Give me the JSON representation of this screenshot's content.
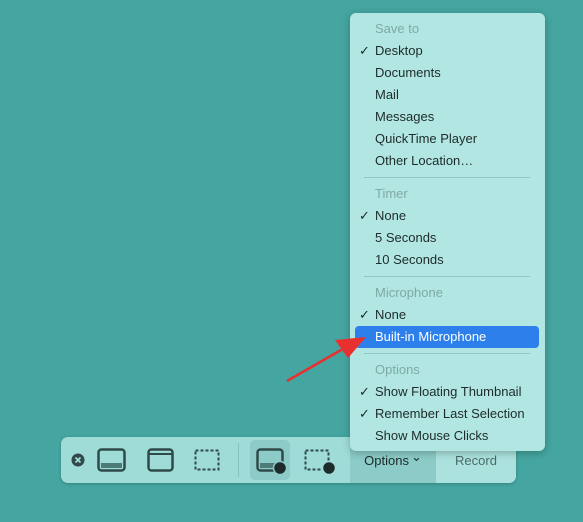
{
  "menu": {
    "save_to": {
      "header": "Save to",
      "items": [
        "Desktop",
        "Documents",
        "Mail",
        "Messages",
        "QuickTime Player",
        "Other Location…"
      ],
      "checked": "Desktop"
    },
    "timer": {
      "header": "Timer",
      "items": [
        "None",
        "5 Seconds",
        "10 Seconds"
      ],
      "checked": "None"
    },
    "microphone": {
      "header": "Microphone",
      "items": [
        "None",
        "Built-in Microphone"
      ],
      "checked": "None",
      "highlighted": "Built-in Microphone"
    },
    "options": {
      "header": "Options",
      "items": [
        "Show Floating Thumbnail",
        "Remember Last Selection",
        "Show Mouse Clicks"
      ],
      "checked": [
        "Show Floating Thumbnail",
        "Remember Last Selection"
      ]
    },
    "check_glyph": "✓"
  },
  "toolbar": {
    "options_label": "Options",
    "options_chevron": "⌄",
    "record_label": "Record",
    "icons": [
      "close-icon",
      "capture-entire-screen-icon",
      "capture-window-icon",
      "capture-selection-icon",
      "record-entire-screen-icon",
      "record-selection-icon"
    ]
  },
  "colors": {
    "background": "#45a5a0",
    "menu": "#b2e6e2",
    "highlight": "#2d80ec",
    "arrow": "#e8302f"
  }
}
